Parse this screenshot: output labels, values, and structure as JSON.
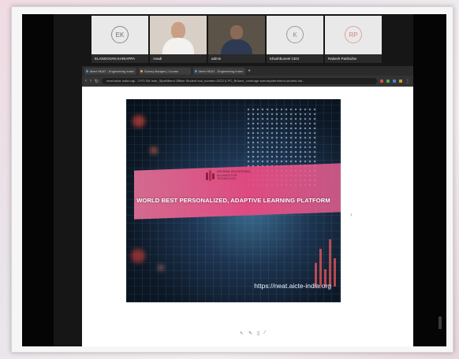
{
  "participants": [
    {
      "initials": "EK",
      "name": "ELANGOVAN KARIAPPA",
      "type": "avatar",
      "color": "#6e6e6e"
    },
    {
      "initials": "",
      "name": "Avadi",
      "type": "video"
    },
    {
      "initials": "",
      "name": "admin",
      "type": "video-dark"
    },
    {
      "initials": "K",
      "name": "Khushbuneel CEO",
      "type": "avatar",
      "color": "#8a8a8a"
    },
    {
      "initials": "RP",
      "name": "Rakesh Parilsiche",
      "type": "avatar",
      "color": "#e07d7d"
    }
  ],
  "browser": {
    "tabs": [
      "Meet HEAT - Engineering Index",
      "Survey Badges | Course",
      "Meet HEAT - Engineering Index"
    ],
    "url": "meet.aicte-india.org/...3 PO Sl4 Instr_SlpsMftend Offline Student tool_number=2022 & PO_Brhave_crsnfrage swtrslspnterrnikrm-student-mk..."
  },
  "slide": {
    "tagline": "WORLD BEST PERSONALIZED, ADAPTIVE LEARNING PLATFORM",
    "url": "https://neat.aicte-india.org",
    "logo_text": "NATIONAL EDUCATIONAL ALLIANCE FOR TECHNOLOGY"
  },
  "colors": {
    "band": "#ec4880",
    "banner_bg": "#0d1826"
  },
  "icons": {
    "next": "chevron-right-icon",
    "controls": [
      "pointer-icon",
      "pen-icon",
      "eraser-icon",
      "annotate-icon"
    ]
  }
}
